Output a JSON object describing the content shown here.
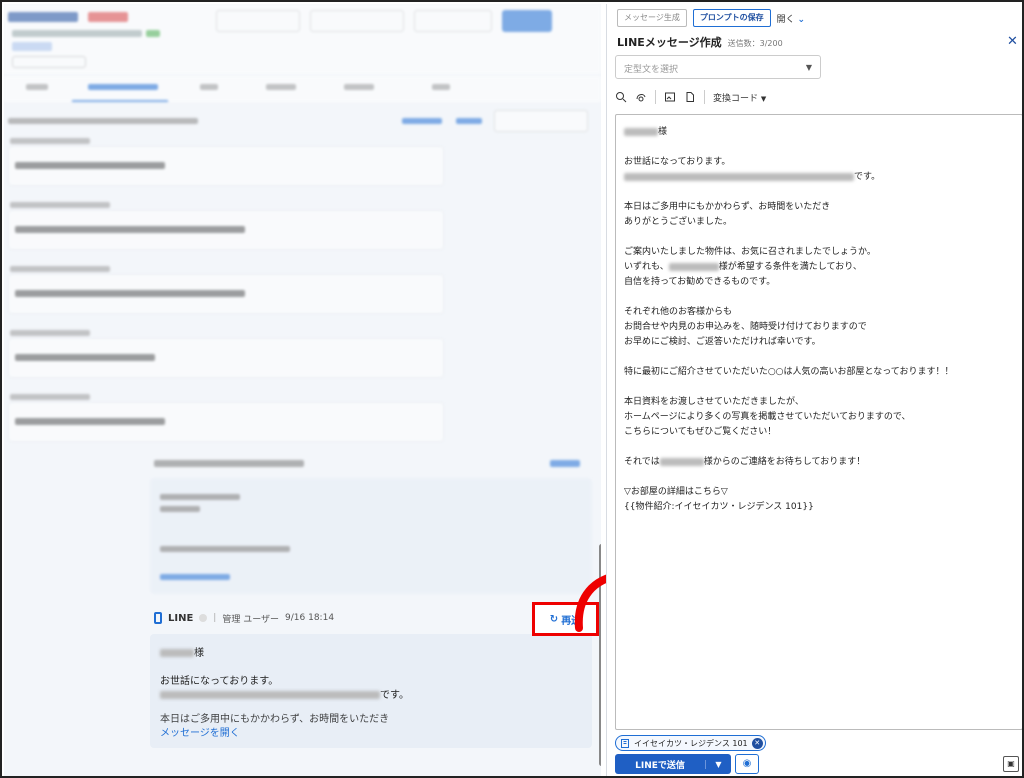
{
  "conversation": {
    "channel": "LINE",
    "sender": "管理 ユーザー",
    "timestamp": "9/16 18:14",
    "resend_label": "再送",
    "message_lines": [
      "様",
      "お世話になっております。",
      "です。",
      "本日はご多用中にもかかわらず、お時間をいただき"
    ],
    "open_message_label": "メッセージを開く"
  },
  "panel": {
    "generate_label": "メッセージ生成",
    "save_prompt_label": "プロンプトの保存",
    "open_label": "開く",
    "title": "LINEメッセージ作成",
    "send_count": "送信数：3/200",
    "template_placeholder": "定型文を選択",
    "convert_code_label": "変換コード",
    "body": {
      "l1": "様",
      "l2": "お世話になっております。",
      "l3": "です。",
      "l4": "本日はご多用中にもかかわらず、お時間をいただき",
      "l5": "ありがとうございました。",
      "l6": "ご案内いたしました物件は、お気に召されましたでしょうか。",
      "l7a": "いずれも、",
      "l7b": "様が希望する条件を満たしており、",
      "l8": "自信を持ってお勧めできるものです。",
      "l9": "それぞれ他のお客様からも",
      "l10": "お問合せや内見のお申込みを、随時受け付けておりますので",
      "l11": "お早めにご検討、ご返答いただければ幸いです。",
      "l12": "特に最初にご紹介させていただいた○○は人気の高いお部屋となっております！！",
      "l13": "本日資料をお渡しさせていただきましたが、",
      "l14": "ホームページにより多くの写真を掲載させていただいておりますので、",
      "l15": "こちらについてもぜひご覧ください！",
      "l16a": "それでは",
      "l16b": "様からのご連絡をお待ちしております！",
      "l17": "▽お部屋の詳細はこちら▽",
      "l18": "{{物件紹介:イイセイカツ・レジデンス 101}}"
    },
    "property_chip": "イイセイカツ・レジデンス 101",
    "send_label": "LINEで送信"
  },
  "colors": {
    "accent": "#1f6ed4",
    "highlight": "#e00000"
  }
}
